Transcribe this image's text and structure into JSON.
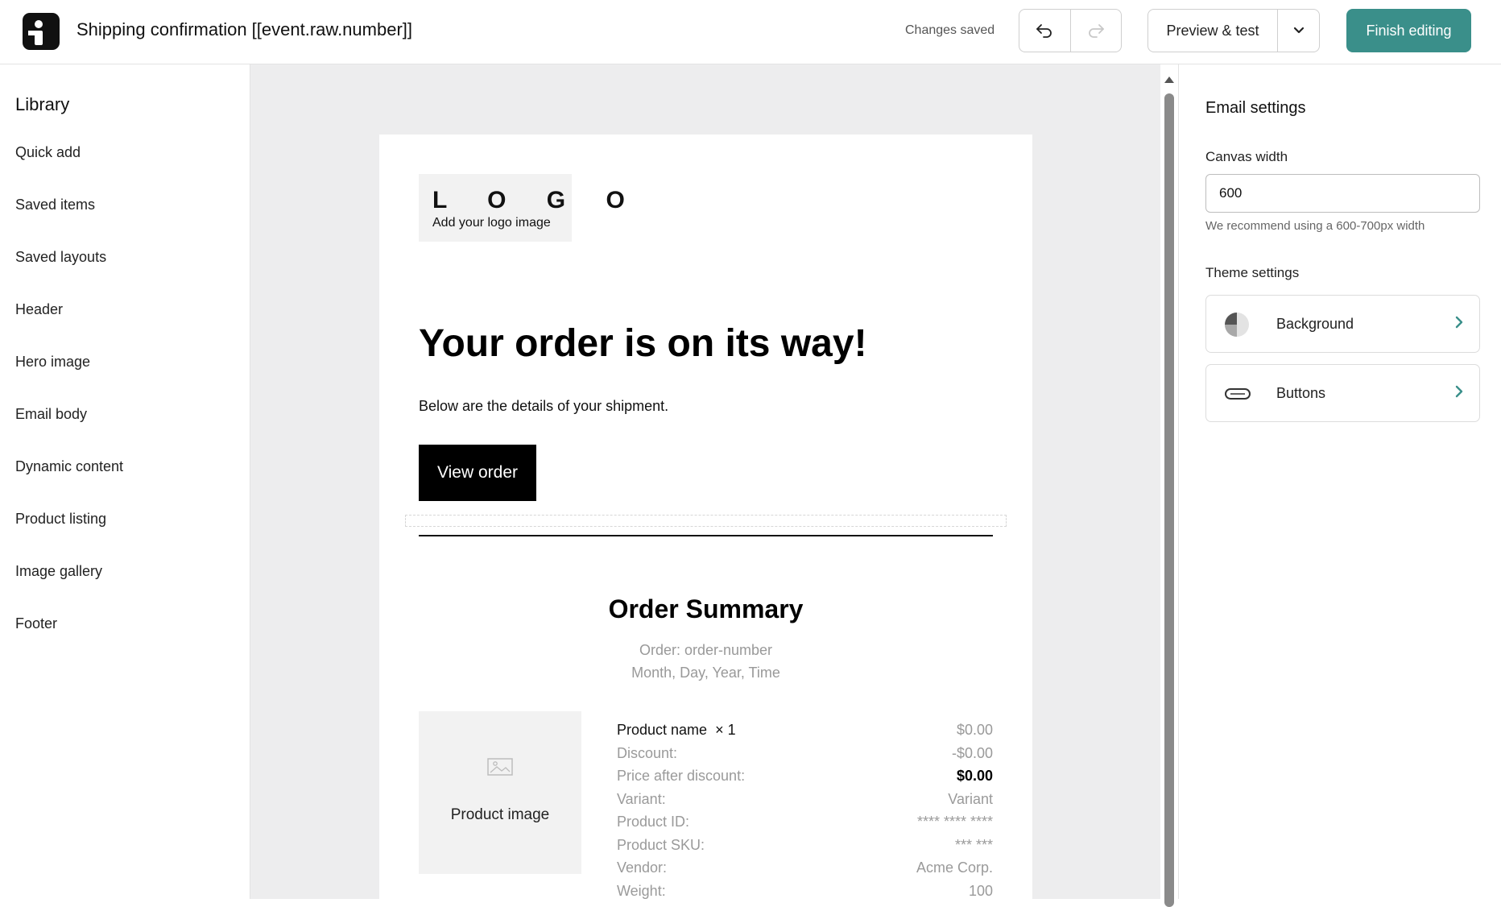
{
  "topbar": {
    "doc_title": "Shipping confirmation [[event.raw.number]]",
    "status": "Changes saved",
    "preview_label": "Preview & test",
    "finish_label": "Finish editing",
    "accent_color": "#3a8f8a"
  },
  "library": {
    "title": "Library",
    "items": [
      "Quick add",
      "Saved items",
      "Saved layouts",
      "Header",
      "Hero image",
      "Email body",
      "Dynamic content",
      "Product listing",
      "Image gallery",
      "Footer"
    ]
  },
  "email": {
    "logo_text": "L O G O",
    "logo_sub": "Add your logo image",
    "headline": "Your order is on its way!",
    "intro": "Below are the details of your shipment.",
    "button_label": "View order",
    "summary_title": "Order Summary",
    "summary_order": "Order: order-number",
    "summary_date": "Month, Day, Year, Time",
    "product_image_label": "Product image",
    "product": {
      "name": "Product name",
      "qty": "× 1",
      "price": "$0.00",
      "rows": [
        {
          "label": "Discount:",
          "value": "-$0.00"
        },
        {
          "label": "Price after discount:",
          "value": "$0.00"
        },
        {
          "label": "Variant:",
          "value": "Variant"
        },
        {
          "label": "Product ID:",
          "value": "**** **** ****"
        },
        {
          "label": "Product SKU:",
          "value": "*** ***"
        },
        {
          "label": "Vendor:",
          "value": "Acme Corp."
        },
        {
          "label": "Weight:",
          "value": "100"
        }
      ]
    }
  },
  "settings": {
    "title": "Email settings",
    "canvas_width_label": "Canvas width",
    "canvas_width_value": "600",
    "canvas_width_hint": "We recommend using a 600-700px width",
    "theme_label": "Theme settings",
    "theme_items": [
      {
        "label": "Background",
        "icon": "background-icon"
      },
      {
        "label": "Buttons",
        "icon": "buttons-icon"
      }
    ]
  }
}
